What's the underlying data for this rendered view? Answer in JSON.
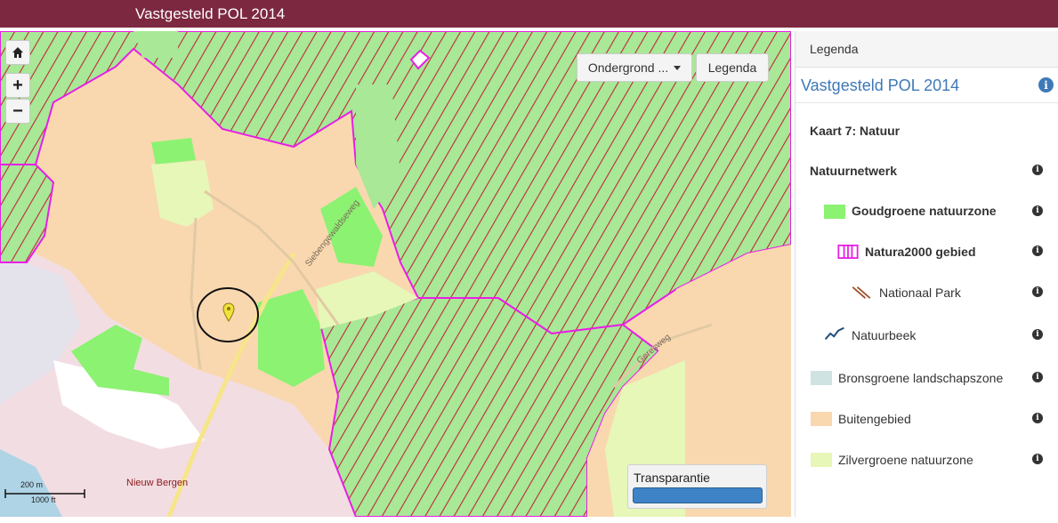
{
  "header": {
    "title": "Vastgesteld POL 2014"
  },
  "map": {
    "controls": {
      "home_icon": "home-icon",
      "zoom_in": "+",
      "zoom_out": "−"
    },
    "basemap_button": "Ondergrond ...",
    "legend_button": "Legenda",
    "transparency_label": "Transparantie",
    "transparency_level": 1.0,
    "scale": {
      "metric": "200 m",
      "imperial": "1000 ft"
    },
    "place_label": "Nieuw Bergen",
    "road_labels": [
      "Siebengewaldseweg",
      "Geresweg"
    ],
    "marker_icon": "location-pin-icon",
    "colors": {
      "natuurnetwerk_green": "#a8e896",
      "hatch": "#c0283c",
      "natura_outline": "#e81ee6",
      "buitengebied": "#f9d8b0",
      "zilvergroen": "#e6f7b8",
      "goudgroen": "#8cf272",
      "urban": "#f2dde2"
    }
  },
  "legend": {
    "header": "Legenda",
    "subtitle": "Vastgesteld POL 2014",
    "map_title": "Kaart 7: Natuur",
    "items": [
      {
        "label": "Natuurnetwerk",
        "bold": true
      },
      {
        "label": "Goudgroene natuurzone",
        "bold": true,
        "color": "#8cf272"
      },
      {
        "label": "Natura2000 gebied",
        "bold": true,
        "color": "#e81ee6"
      },
      {
        "label": "Nationaal Park",
        "bold": false,
        "color": "#a0522d"
      },
      {
        "label": "Natuurbeek",
        "bold": false,
        "color": "#1f4e79"
      },
      {
        "label": "Bronsgroene landschapszone",
        "bold": false,
        "color": "#cfe3e3"
      },
      {
        "label": "Buitengebied",
        "bold": false,
        "color": "#f9d8b0"
      },
      {
        "label": "Zilvergroene natuurzone",
        "bold": false,
        "color": "#e6f7b8"
      }
    ]
  }
}
